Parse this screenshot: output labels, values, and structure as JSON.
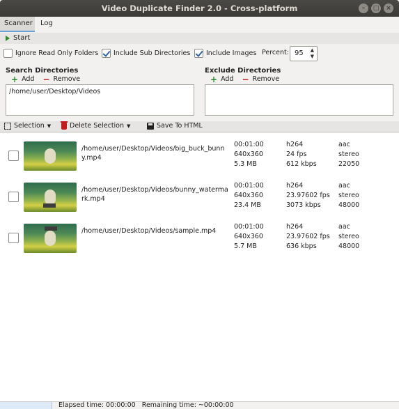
{
  "window": {
    "title": "Video Duplicate Finder 2.0 - Cross-platform"
  },
  "tabs": [
    {
      "label": "Scanner"
    },
    {
      "label": "Log"
    }
  ],
  "toolbar": {
    "start_label": "Start"
  },
  "options": {
    "ignore_read_only": {
      "label": "Ignore Read Only Folders",
      "checked": false
    },
    "include_sub_dirs": {
      "label": "Include Sub Directories",
      "checked": true
    },
    "include_images": {
      "label": "Include Images",
      "checked": true
    },
    "percent_label": "Percent:",
    "percent_value": "95"
  },
  "search_dirs": {
    "title": "Search Directories",
    "add_label": "Add",
    "remove_label": "Remove",
    "entries": [
      "/home/user/Desktop/Videos"
    ]
  },
  "exclude_dirs": {
    "title": "Exclude Directories",
    "add_label": "Add",
    "remove_label": "Remove",
    "entries": []
  },
  "selection_toolbar": {
    "selection_label": "Selection",
    "delete_label": "Delete Selection",
    "save_label": "Save To HTML"
  },
  "results": [
    {
      "path": "/home/user/Desktop/Videos/big_buck_bunny.mp4",
      "duration": "00:01:00",
      "resolution": "640x360",
      "size": "5.3 MB",
      "codec": "h264",
      "fps": "24 fps",
      "bitrate": "612 kbps",
      "audio": "aac",
      "channels": "stereo",
      "sample_rate": "22050",
      "checked": false
    },
    {
      "path": "/home/user/Desktop/Videos/bunny_watermark.mp4",
      "duration": "00:01:00",
      "resolution": "640x360",
      "size": "23.4 MB",
      "codec": "h264",
      "fps": "23.97602 fps",
      "bitrate": "3073 kbps",
      "audio": "aac",
      "channels": "stereo",
      "sample_rate": "48000",
      "checked": false
    },
    {
      "path": "/home/user/Desktop/Videos/sample.mp4",
      "duration": "00:01:00",
      "resolution": "640x360",
      "size": "5.7 MB",
      "codec": "h264",
      "fps": "23.97602 fps",
      "bitrate": "636 kbps",
      "audio": "aac",
      "channels": "stereo",
      "sample_rate": "48000",
      "checked": false
    }
  ],
  "status": {
    "elapsed": "Elapsed time: 00:00:00",
    "remaining": "Remaining time: ~00:00:00"
  },
  "colors": {
    "accent": "#6a9fd4",
    "add": "#2c8a2c",
    "remove": "#c21b1b",
    "titlebar": "#3b3a36"
  }
}
